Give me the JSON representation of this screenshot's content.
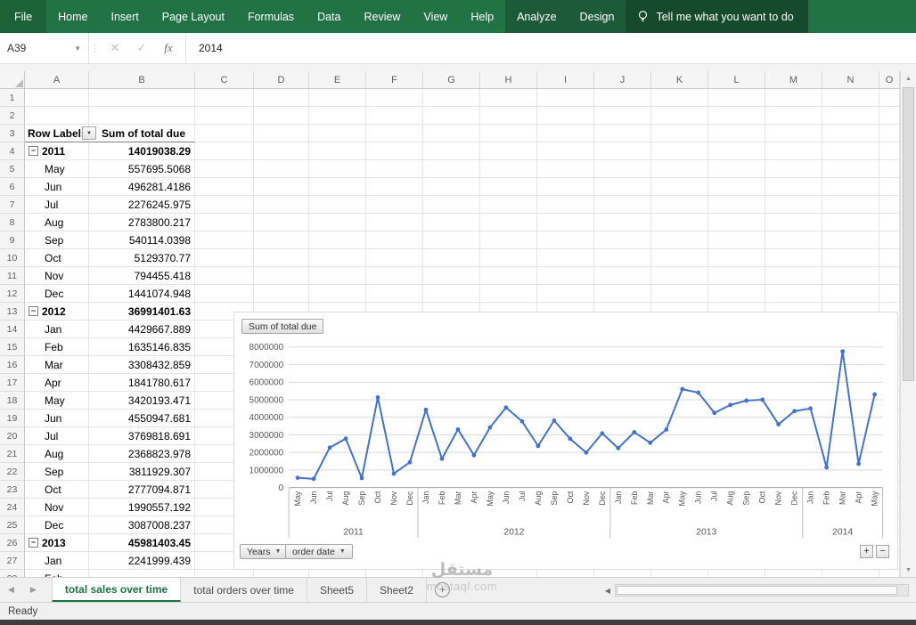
{
  "colors": {
    "ribbon_green": "#217346",
    "ribbon_contextual_green": "#1d5a37",
    "ribbon_file_green": "#1b6239",
    "tellme_green": "#164a2c",
    "accent_green": "#217346",
    "chart_line_blue": "#4472C4"
  },
  "ribbon": {
    "tabs": [
      {
        "label": "File",
        "type": "file"
      },
      {
        "label": "Home",
        "type": "normal"
      },
      {
        "label": "Insert",
        "type": "normal"
      },
      {
        "label": "Page Layout",
        "type": "normal"
      },
      {
        "label": "Formulas",
        "type": "normal"
      },
      {
        "label": "Data",
        "type": "normal"
      },
      {
        "label": "Review",
        "type": "normal"
      },
      {
        "label": "View",
        "type": "normal"
      },
      {
        "label": "Help",
        "type": "normal"
      },
      {
        "label": "Analyze",
        "type": "contextual"
      },
      {
        "label": "Design",
        "type": "contextual"
      }
    ],
    "tell_me_label": "Tell me what you want to do"
  },
  "formula_bar": {
    "name_box": "A39",
    "cancel": "✕",
    "enter": "✓",
    "fx": "fx",
    "value": "2014"
  },
  "grid": {
    "column_headers": [
      "A",
      "B",
      "C",
      "D",
      "E",
      "F",
      "G",
      "H",
      "I",
      "J",
      "K",
      "L",
      "M",
      "N",
      "O"
    ],
    "visible_rows": 28,
    "pivot_table": {
      "header": {
        "row_labels": "Row Labels",
        "value_header": "Sum of total due"
      },
      "rows": [
        {
          "label": "2011",
          "value": "14019038.29",
          "level": "year"
        },
        {
          "label": "May",
          "value": "557695.5068",
          "level": "month"
        },
        {
          "label": "Jun",
          "value": "496281.4186",
          "level": "month"
        },
        {
          "label": "Jul",
          "value": "2276245.975",
          "level": "month"
        },
        {
          "label": "Aug",
          "value": "2783800.217",
          "level": "month"
        },
        {
          "label": "Sep",
          "value": "540114.0398",
          "level": "month"
        },
        {
          "label": "Oct",
          "value": "5129370.77",
          "level": "month"
        },
        {
          "label": "Nov",
          "value": "794455.418",
          "level": "month"
        },
        {
          "label": "Dec",
          "value": "1441074.948",
          "level": "month"
        },
        {
          "label": "2012",
          "value": "36991401.63",
          "level": "year"
        },
        {
          "label": "Jan",
          "value": "4429667.889",
          "level": "month"
        },
        {
          "label": "Feb",
          "value": "1635146.835",
          "level": "month"
        },
        {
          "label": "Mar",
          "value": "3308432.859",
          "level": "month"
        },
        {
          "label": "Apr",
          "value": "1841780.617",
          "level": "month"
        },
        {
          "label": "May",
          "value": "3420193.471",
          "level": "month"
        },
        {
          "label": "Jun",
          "value": "4550947.681",
          "level": "month"
        },
        {
          "label": "Jul",
          "value": "3769818.691",
          "level": "month"
        },
        {
          "label": "Aug",
          "value": "2368823.978",
          "level": "month"
        },
        {
          "label": "Sep",
          "value": "3811929.307",
          "level": "month"
        },
        {
          "label": "Oct",
          "value": "2777094.871",
          "level": "month"
        },
        {
          "label": "Nov",
          "value": "1990557.192",
          "level": "month"
        },
        {
          "label": "Dec",
          "value": "3087008.237",
          "level": "month"
        },
        {
          "label": "2013",
          "value": "45981403.45",
          "level": "year"
        },
        {
          "label": "Jan",
          "value": "2241999.439",
          "level": "month"
        },
        {
          "label": "Feb",
          "value": "",
          "level": "month"
        }
      ]
    }
  },
  "chart_data": {
    "type": "line",
    "series_name": "Sum of total due",
    "value_field_button": "Sum of total due",
    "axis_field_buttons": [
      "Years",
      "order date"
    ],
    "legend": "none",
    "grid": true,
    "line_color": "#4472C4",
    "ylim": [
      0,
      8000000
    ],
    "ytick_interval": 1000000,
    "ytick_labels": [
      "0",
      "1000000",
      "2000000",
      "3000000",
      "4000000",
      "5000000",
      "6000000",
      "7000000",
      "8000000"
    ],
    "year_groups": [
      {
        "year": "2011",
        "months": [
          "May",
          "Jun",
          "Jul",
          "Aug",
          "Sep",
          "Oct",
          "Nov",
          "Dec"
        ]
      },
      {
        "year": "2012",
        "months": [
          "Jan",
          "Feb",
          "Mar",
          "Apr",
          "May",
          "Jun",
          "Jul",
          "Aug",
          "Sep",
          "Oct",
          "Nov",
          "Dec"
        ]
      },
      {
        "year": "2013",
        "months": [
          "Jan",
          "Feb",
          "Mar",
          "Apr",
          "May",
          "Jun",
          "Jul",
          "Aug",
          "Sep",
          "Oct",
          "Nov",
          "Dec"
        ]
      },
      {
        "year": "2014",
        "months": [
          "Jan",
          "Feb",
          "Mar",
          "Apr",
          "May"
        ]
      }
    ],
    "values": [
      557695.5068,
      496281.4186,
      2276245.975,
      2783800.217,
      540114.0398,
      5129370.77,
      794455.418,
      1441074.948,
      4429667.889,
      1635146.835,
      3308432.859,
      1841780.617,
      3420193.471,
      4550947.681,
      3769818.691,
      2368823.978,
      3811929.307,
      2777094.871,
      1990557.192,
      3087008.237,
      2241999.439,
      3150000,
      2550000,
      3300000,
      5600000,
      5400000,
      4250000,
      4700000,
      4950000,
      5000000,
      3600000,
      4350000,
      4500000,
      1150000,
      7750000,
      1350000,
      5300000
    ]
  },
  "sheet_tabs": {
    "tabs": [
      {
        "label": "total sales over time",
        "active": true
      },
      {
        "label": "total orders over time",
        "active": false
      },
      {
        "label": "Sheet5",
        "active": false
      },
      {
        "label": "Sheet2",
        "active": false
      }
    ],
    "add_sheet": "+"
  },
  "status_bar": {
    "mode": "Ready"
  },
  "watermark": {
    "arabic": "مستقل",
    "domain": "mostaql.com"
  }
}
